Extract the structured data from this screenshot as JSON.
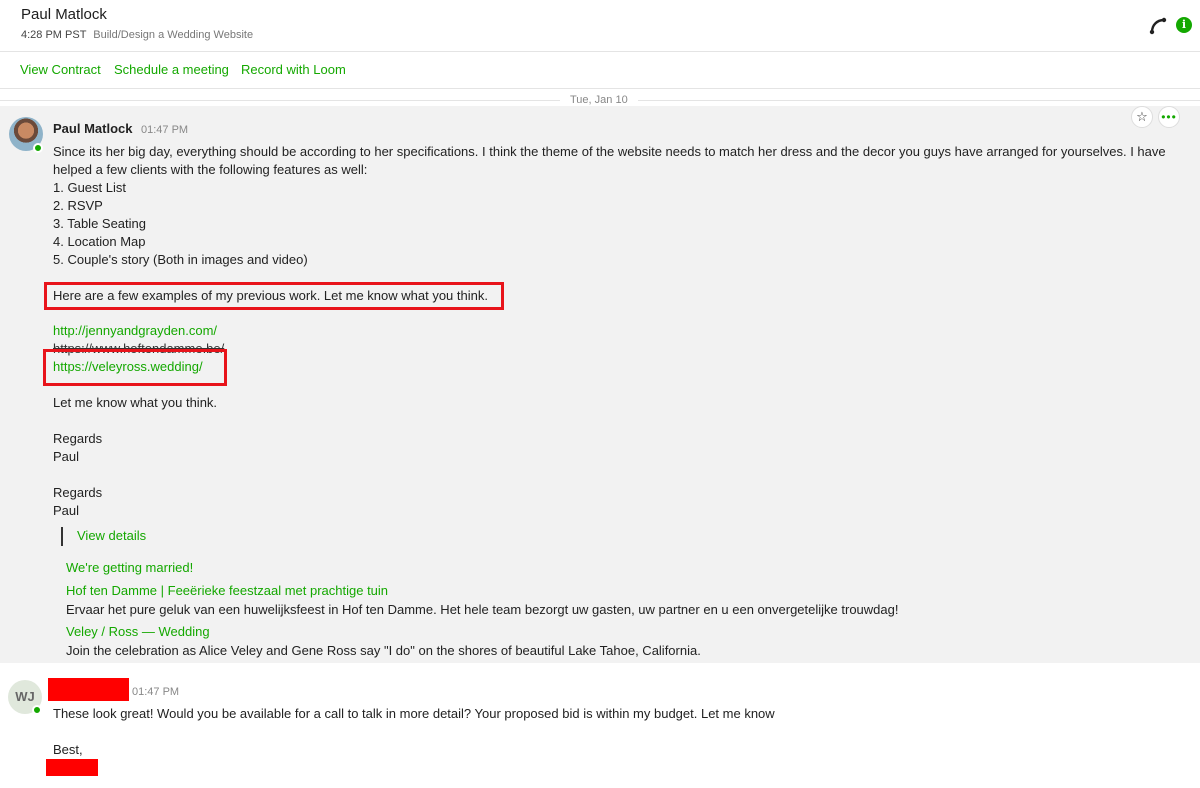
{
  "header": {
    "name": "Paul Matlock",
    "time": "4:28 PM PST",
    "project": "Build/Design a Wedding Website",
    "phone_icon": "phone-icon",
    "info_icon": "info-icon",
    "info_glyph": "i",
    "accent_color": "#14a800"
  },
  "actions": {
    "view_contract": "View Contract",
    "schedule": "Schedule a meeting",
    "loom": "Record with Loom"
  },
  "date_divider": "Tue, Jan 10",
  "message1": {
    "sender": "Paul Matlock",
    "time": "01:47 PM",
    "star_icon": "☆",
    "more_icon": "•••",
    "lines": [
      "Since its her big day, everything should be according to her specifications. I think the theme of the website needs to match her dress and the decor you guys have arranged for yourselves. I have",
      "helped a few clients with the following features as well:",
      "1. Guest List",
      "2. RSVP",
      "3. Table Seating",
      "4. Location Map",
      "5. Couple's story (Both in images and video)",
      "Here are a few examples of my previous work. Let me know what you think."
    ],
    "links": [
      "http://jennyandgrayden.com/",
      "https://www.hoftendamme.be/",
      "https://veleyross.wedding/"
    ],
    "after_links": [
      "Let me know what you think.",
      "Regards",
      "Paul",
      "Regards",
      "Paul"
    ],
    "view_details": "View details",
    "previews": [
      {
        "title": "We're getting married!",
        "desc": ""
      },
      {
        "title": "Hof ten Damme | Feeërieke feestzaal met prachtige tuin",
        "desc": "Ervaar het pure geluk van een huwelijksfeest in Hof ten Damme. Het hele team bezorgt uw gasten, uw partner en u een onvergetelijke trouwdag!"
      },
      {
        "title": "Veley / Ross — Wedding",
        "desc": "Join the celebration as Alice Veley and Gene Ross say \"I do\" on the shores of beautiful Lake Tahoe, California."
      }
    ]
  },
  "message2": {
    "initials": "WJ",
    "time": "01:47 PM",
    "text": "These look great! Would you be available for a call to talk in more detail? Your proposed bid is within my budget. Let me know",
    "sign_off": "Best,"
  }
}
